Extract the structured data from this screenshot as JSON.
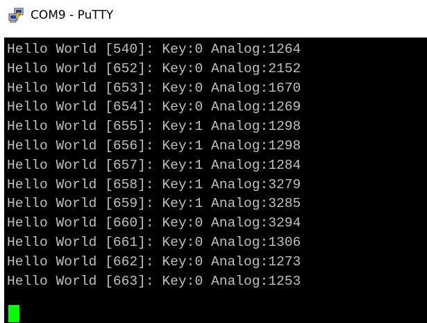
{
  "window": {
    "title": "COM9 - PuTTY",
    "icon": "putty-icon"
  },
  "terminal": {
    "background": "#000000",
    "text_color": "#c0c0c0",
    "cursor_color": "#00ff00",
    "lines": [
      "Hello World [540]: Key:0 Analog:1264",
      "Hello World [652]: Key:0 Analog:2152",
      "Hello World [653]: Key:0 Analog:1670",
      "Hello World [654]: Key:0 Analog:1269",
      "Hello World [655]: Key:1 Analog:1298",
      "Hello World [656]: Key:1 Analog:1298",
      "Hello World [657]: Key:1 Analog:1284",
      "Hello World [658]: Key:1 Analog:3279",
      "Hello World [659]: Key:1 Analog:3285",
      "Hello World [660]: Key:0 Analog:3294",
      "Hello World [661]: Key:0 Analog:1306",
      "Hello World [662]: Key:0 Analog:1273",
      "Hello World [663]: Key:0 Analog:1253"
    ]
  }
}
